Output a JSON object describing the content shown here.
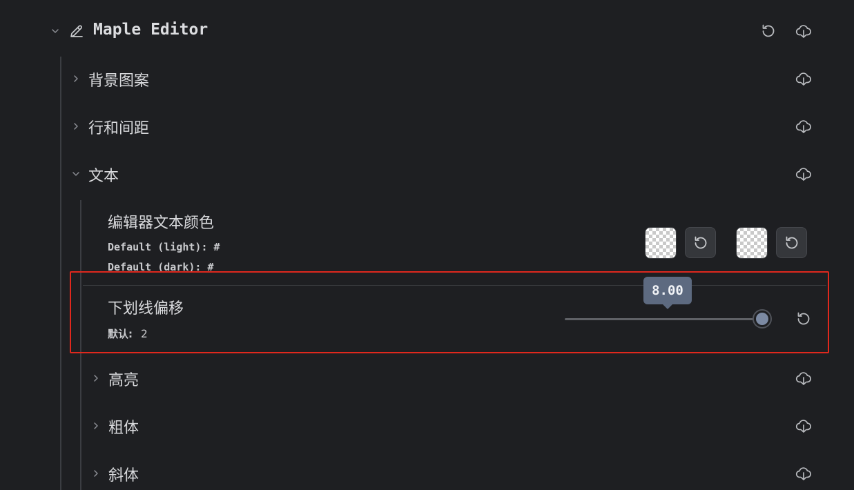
{
  "header": {
    "title": "Maple Editor",
    "icons": [
      "chevron-down-icon",
      "pencil-icon",
      "reset-icon",
      "cloud-download-icon"
    ]
  },
  "sections": [
    {
      "label": "背景图案",
      "expanded": false
    },
    {
      "label": "行和间距",
      "expanded": false
    },
    {
      "label": "文本",
      "expanded": true
    }
  ],
  "text_color_setting": {
    "title": "编辑器文本颜色",
    "default_light": "Default (light): #",
    "default_dark": "Default (dark): #"
  },
  "underline_offset_setting": {
    "title": "下划线偏移",
    "default_label": "默认:",
    "default_value": "2",
    "slider_value": "8.00",
    "slider_level": 1.0
  },
  "subsections": [
    {
      "label": "高亮"
    },
    {
      "label": "粗体"
    },
    {
      "label": "斜体"
    }
  ],
  "colors": {
    "background": "#1e1f22",
    "highlight_box": "#e0281d",
    "tooltip": "#5d6a80",
    "slider_knob": "#7c8aa3"
  }
}
